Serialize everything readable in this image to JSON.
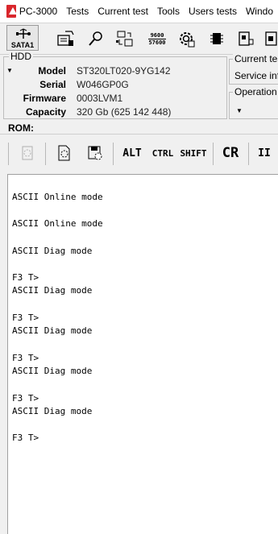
{
  "app": {
    "title": "PC-3000"
  },
  "menu": [
    "Tests",
    "Current test",
    "Tools",
    "Users tests",
    "Windo"
  ],
  "toolbar": {
    "sata_label": "SATA1",
    "baud_top": "9600",
    "baud_bottom": "57600"
  },
  "hdd": {
    "legend": "HDD",
    "fields": [
      {
        "label": "Model",
        "value": "ST320LT020-9YG142"
      },
      {
        "label": "Serial",
        "value": "W046GP0G"
      },
      {
        "label": "Firmware",
        "value": "0003LVM1"
      },
      {
        "label": "Capacity",
        "value": "320 Gb (625 142 448)"
      }
    ]
  },
  "current_test": {
    "legend": "Current tes",
    "value": "Service info"
  },
  "operation": {
    "legend": "Operation"
  },
  "rom": {
    "label": "ROM:"
  },
  "terminal_toolbar": {
    "alt": "ALT",
    "ctrl": "CTRL",
    "shift": "SHIFT",
    "cr": "CR",
    "pause": "II"
  },
  "terminal": {
    "lines": [
      "ASCII Online mode",
      "ASCII Online mode",
      "ASCII Diag mode",
      "F3 T>",
      "ASCII Diag mode",
      "F3 T>",
      "ASCII Diag mode",
      "F3 T>",
      "ASCII Diag mode",
      "F3 T>",
      "ASCII Diag mode",
      "F3 T>"
    ]
  },
  "colors": {
    "accent": "#d9262c",
    "terminal_bg": "#ffffff"
  }
}
